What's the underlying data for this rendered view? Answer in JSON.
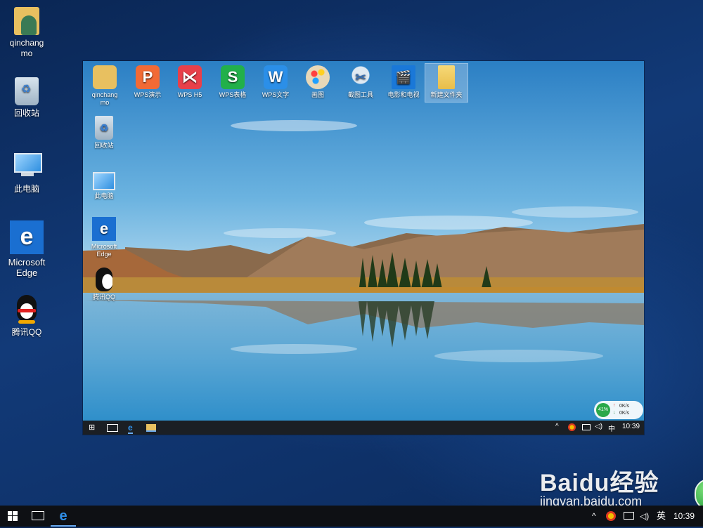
{
  "desktop": {
    "icons": [
      {
        "label": "qinchangmo",
        "icon": "user-folder-icon"
      },
      {
        "label": "回收站",
        "icon": "recycle-bin-icon"
      },
      {
        "label": "此电脑",
        "icon": "this-pc-icon"
      },
      {
        "label": "Microsoft Edge",
        "icon": "edge-icon"
      },
      {
        "label": "腾讯QQ",
        "icon": "qq-icon"
      }
    ]
  },
  "inner_screen": {
    "top_icons": [
      {
        "label": "qinchangmo",
        "icon": "user-folder-icon"
      },
      {
        "label": "WPS演示",
        "icon": "wps-presentation-icon",
        "glyph": "P",
        "color": "#f26a35"
      },
      {
        "label": "WPS H5",
        "icon": "wps-h5-icon",
        "glyph": "⋉",
        "color": "#e8404a"
      },
      {
        "label": "WPS表格",
        "icon": "wps-spreadsheet-icon",
        "glyph": "S",
        "color": "#22b04a"
      },
      {
        "label": "WPS文字",
        "icon": "wps-writer-icon",
        "glyph": "W",
        "color": "#2b8fe8"
      },
      {
        "label": "画图",
        "icon": "paint-icon"
      },
      {
        "label": "截图工具",
        "icon": "snipping-tool-icon"
      },
      {
        "label": "电影和电视",
        "icon": "movies-tv-icon"
      },
      {
        "label": "新建文件夹",
        "icon": "new-folder-icon"
      }
    ],
    "left_icons": [
      {
        "label": "回收站",
        "icon": "recycle-bin-icon"
      },
      {
        "label": "此电脑",
        "icon": "this-pc-icon"
      },
      {
        "label": "Microsoft Edge",
        "icon": "edge-icon"
      },
      {
        "label": "腾讯QQ",
        "icon": "qq-icon"
      }
    ],
    "speed_widget": {
      "percent": "41%",
      "upload": "0K/s",
      "download": "0K/s"
    },
    "taskbar": {
      "ime": "中",
      "clock": "10:39"
    }
  },
  "taskbar": {
    "start_icon": "windows-logo-icon",
    "task_view_icon": "task-view-icon",
    "pinned": [
      "edge-icon"
    ],
    "tray": {
      "ime": "英",
      "clock": "10:39"
    }
  },
  "watermark": {
    "logo_text": "Baidu经验",
    "url": "jingyan.baidu.com"
  },
  "colors": {
    "taskbar": "#0e1014",
    "accent": "#1a6fd1"
  }
}
